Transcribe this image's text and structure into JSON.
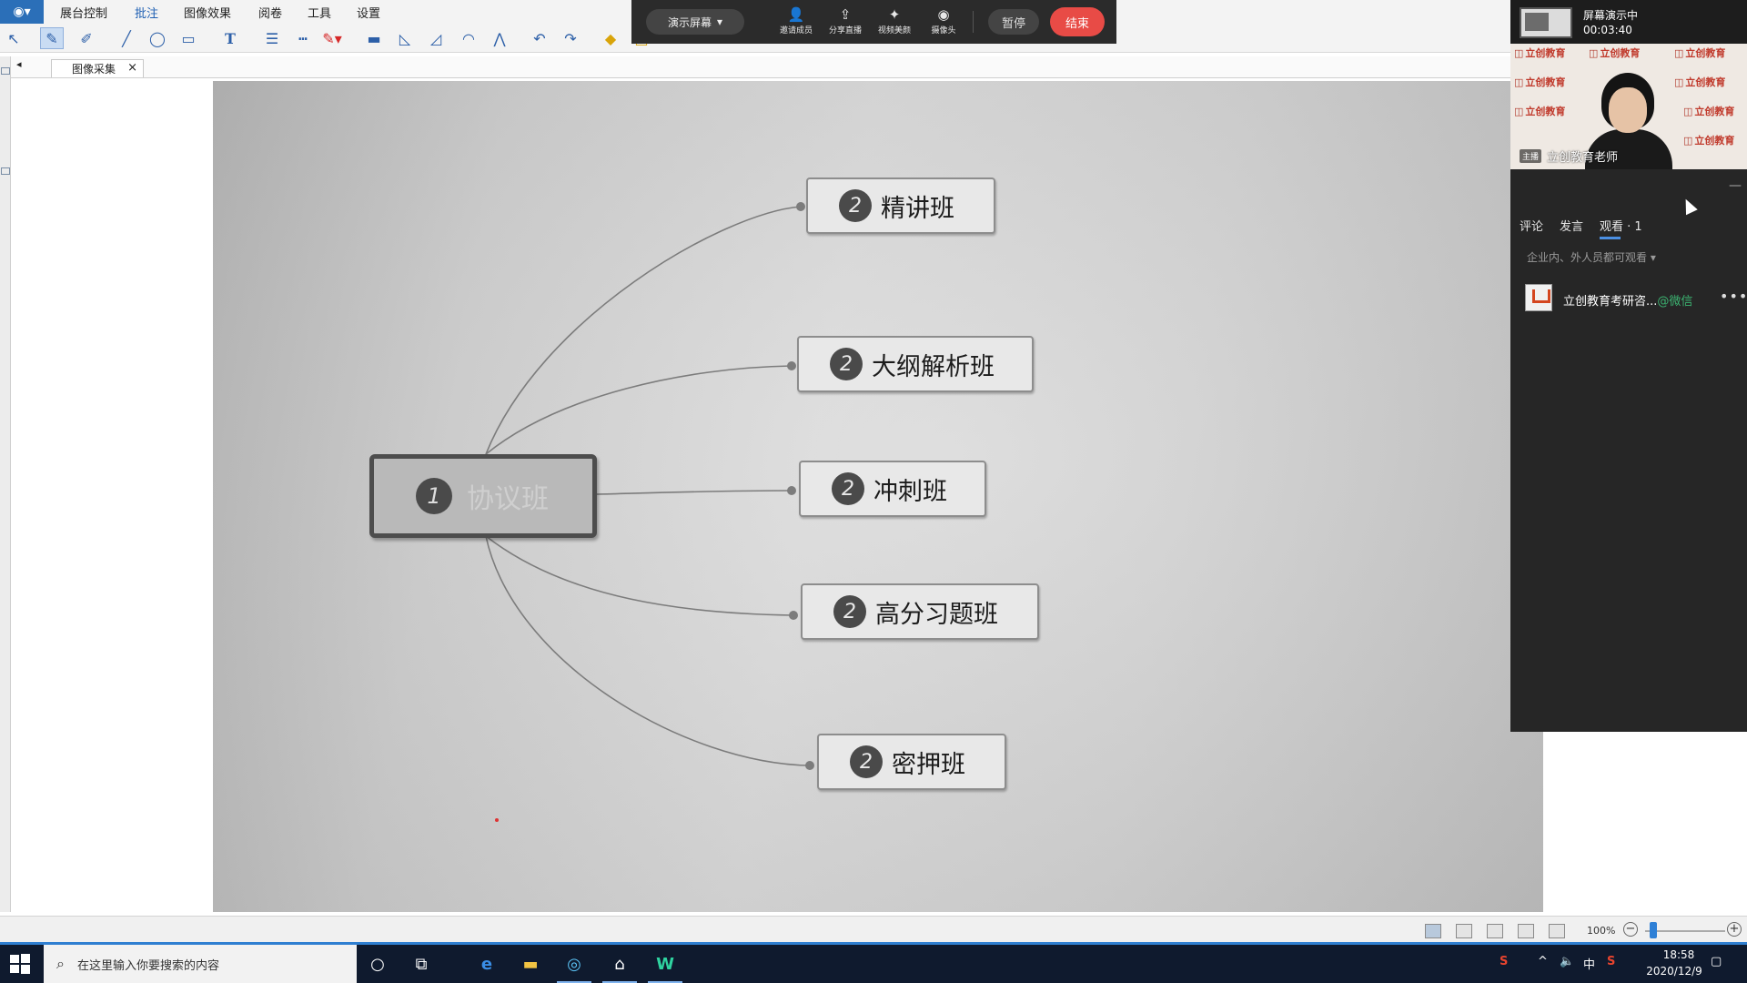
{
  "menu": {
    "items": [
      "展台控制",
      "批注",
      "图像效果",
      "阅卷",
      "工具",
      "设置"
    ],
    "active": "批注"
  },
  "toolbar": {
    "tools": [
      "select-tool",
      "pen-tool",
      "highlighter-tool",
      "line-tool",
      "ellipse-tool",
      "rectangle-tool",
      "text-tool",
      "line-weight-tool",
      "line-style-tool",
      "color-tool",
      "ruler-tool",
      "triangle-tool",
      "set-square-tool",
      "protractor-tool",
      "compass-tool",
      "undo-tool",
      "redo-tool",
      "eraser-tool",
      "image-tool"
    ]
  },
  "tab": {
    "label": "图像采集",
    "close": "×"
  },
  "mindmap": {
    "root": {
      "number": "1",
      "label": "协议班"
    },
    "children": [
      {
        "number": "2",
        "label": "精讲班"
      },
      {
        "number": "2",
        "label": "大纲解析班"
      },
      {
        "number": "2",
        "label": "冲刺班"
      },
      {
        "number": "2",
        "label": "高分习题班"
      },
      {
        "number": "2",
        "label": "密押班"
      }
    ]
  },
  "present_bar": {
    "mode": "演示屏幕",
    "buttons": [
      {
        "label": "邀请成员",
        "icon": "invite-icon"
      },
      {
        "label": "分享直播",
        "icon": "share-icon"
      },
      {
        "label": "视频美颜",
        "icon": "beauty-icon"
      },
      {
        "label": "摄像头",
        "icon": "camera-icon"
      }
    ],
    "pause": "暂停",
    "end": "结束"
  },
  "right_panel": {
    "status_label": "屏幕演示中",
    "timer": "00:03:40",
    "camera": {
      "tag": "主播",
      "name": "立创教育老师",
      "watermark": "立创教育"
    },
    "minimize": "—",
    "tabs": [
      "评论",
      "发言",
      "观看 · 1"
    ],
    "visibility": "企业内、外人员都可观看",
    "viewer": {
      "name": "立创教育考研咨...",
      "source": "@微信",
      "more": "•••"
    }
  },
  "bottom": {
    "zoom": "100%",
    "zoom_level": 0.1
  },
  "taskbar": {
    "search_placeholder": "在这里输入你要搜索的内容",
    "tray_ime": "中",
    "time": "18:58",
    "date": "2020/12/9"
  },
  "colors": {
    "accent": "#1e5fb3",
    "end_button": "#e84b46",
    "panel_bg": "#262626",
    "taskbar_bg": "#0f1a2e",
    "wechat_green": "#3cb371"
  }
}
